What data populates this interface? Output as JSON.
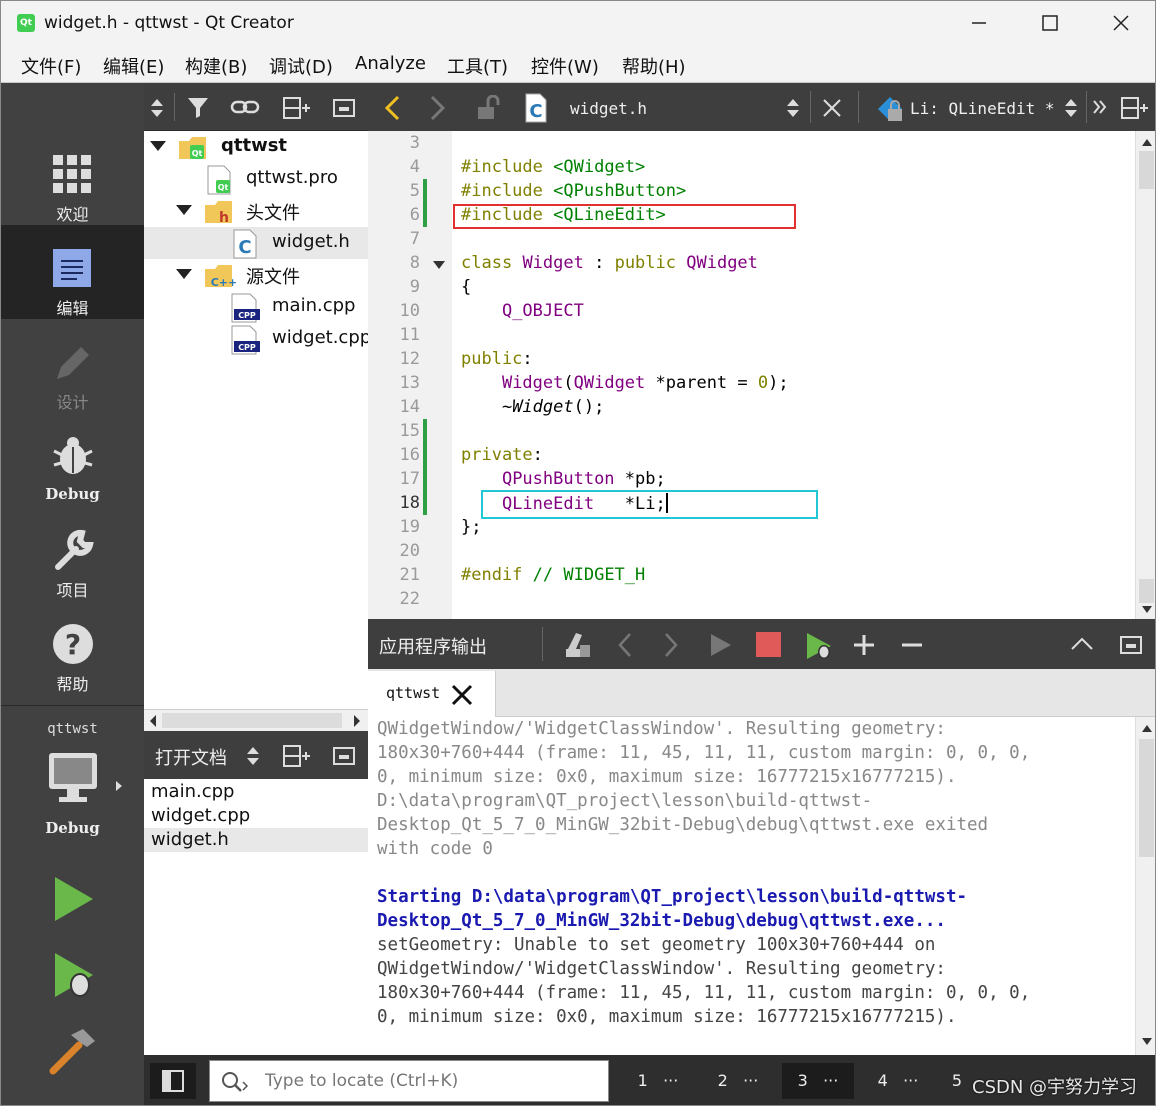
{
  "window": {
    "title": "widget.h - qttwst - Qt Creator",
    "app_icon_text": "Qt"
  },
  "menu": [
    "文件(F)",
    "编辑(E)",
    "构建(B)",
    "调试(D)",
    "Analyze",
    "工具(T)",
    "控件(W)",
    "帮助(H)"
  ],
  "modes": [
    {
      "label": "欢迎",
      "icon": "grid-icon"
    },
    {
      "label": "编辑",
      "icon": "edit-doc-icon",
      "active": true
    },
    {
      "label": "设计",
      "icon": "pencil-icon",
      "disabled": true
    },
    {
      "label": "Debug",
      "icon": "bug-icon"
    },
    {
      "label": "项目",
      "icon": "wrench-icon"
    },
    {
      "label": "帮助",
      "icon": "help-icon"
    }
  ],
  "kit": {
    "project": "qttwst",
    "config": "Debug"
  },
  "project_tree": [
    {
      "label": "qttwst",
      "bold": true,
      "icon": "qt-folder-icon"
    },
    {
      "label": "qttwst.pro",
      "icon": "qt-pro-file-icon"
    },
    {
      "label": "头文件",
      "icon": "header-folder-icon"
    },
    {
      "label": "widget.h",
      "icon": "c-header-file-icon",
      "selected": true
    },
    {
      "label": "源文件",
      "icon": "source-folder-icon"
    },
    {
      "label": "main.cpp",
      "icon": "cpp-file-icon"
    },
    {
      "label": "widget.cpp",
      "icon": "cpp-file-icon"
    }
  ],
  "open_docs": {
    "title": "打开文档",
    "items": [
      "main.cpp",
      "widget.cpp",
      "widget.h"
    ],
    "selected": "widget.h"
  },
  "editor": {
    "file_name": "widget.h",
    "symbol": "Li: QLineEdit *",
    "lines": [
      {
        "n": "3",
        "html": ""
      },
      {
        "n": "4",
        "html": "<span class=\"kw\">#include</span> <span class=\"str\">&lt;QWidget&gt;</span>"
      },
      {
        "n": "5",
        "html": "<span class=\"kw\">#include</span> <span class=\"str\">&lt;QPushButton&gt;</span>"
      },
      {
        "n": "6",
        "html": "<span class=\"kw\">#include</span> <span class=\"str\">&lt;QLineEdit&gt;</span>"
      },
      {
        "n": "7",
        "html": ""
      },
      {
        "n": "8",
        "html": "<span class=\"kw\">class</span> <span class=\"typ\">Widget</span> : <span class=\"kw\">public</span> <span class=\"typ\">QWidget</span>"
      },
      {
        "n": "9",
        "html": "{"
      },
      {
        "n": "10",
        "html": "    <span class=\"typ\">Q_OBJECT</span>"
      },
      {
        "n": "11",
        "html": ""
      },
      {
        "n": "12",
        "html": "<span class=\"kw\">public</span>:"
      },
      {
        "n": "13",
        "html": "    <span class=\"typ\">Widget</span>(<span class=\"typ\">QWidget</span> *parent = <span class=\"kw\">0</span>);"
      },
      {
        "n": "14",
        "html": "    ~<i>Widget</i>();"
      },
      {
        "n": "15",
        "html": ""
      },
      {
        "n": "16",
        "html": "<span class=\"kw\">private</span>:"
      },
      {
        "n": "17",
        "html": "    <span class=\"typ\">QPushButton</span> *pb;"
      },
      {
        "n": "18",
        "html": "    <span class=\"typ\">QLineEdit</span>   *Li;"
      },
      {
        "n": "19",
        "html": "};"
      },
      {
        "n": "20",
        "html": ""
      },
      {
        "n": "21",
        "html": "<span class=\"kw\">#endif</span> <span class=\"cm\">// WIDGET_H</span>"
      },
      {
        "n": "22",
        "html": ""
      }
    ],
    "current_line": "18"
  },
  "output": {
    "title": "应用程序输出",
    "tab": "qttwst",
    "lines": [
      {
        "cls": "out-gray",
        "text": "QWidgetWindow/'WidgetClassWindow'. Resulting geometry:"
      },
      {
        "cls": "out-gray",
        "text": "180x30+760+444 (frame: 11, 45, 11, 11, custom margin: 0, 0, 0,"
      },
      {
        "cls": "out-gray",
        "text": "0, minimum size: 0x0, maximum size: 16777215x16777215)."
      },
      {
        "cls": "out-gray",
        "text": "D:\\data\\program\\QT_project\\lesson\\build-qttwst-"
      },
      {
        "cls": "out-gray",
        "text": "Desktop_Qt_5_7_0_MinGW_32bit-Debug\\debug\\qttwst.exe exited"
      },
      {
        "cls": "out-gray",
        "text": "with code 0"
      },
      {
        "cls": "out-gray",
        "text": ""
      },
      {
        "cls": "out-blue",
        "text": "Starting D:\\data\\program\\QT_project\\lesson\\build-qttwst-"
      },
      {
        "cls": "out-blue",
        "text": "Desktop_Qt_5_7_0_MinGW_32bit-Debug\\debug\\qttwst.exe..."
      },
      {
        "cls": "out-dark",
        "text": "setGeometry: Unable to set geometry 100x30+760+444 on"
      },
      {
        "cls": "out-dark",
        "text": "QWidgetWindow/'WidgetClassWindow'. Resulting geometry:"
      },
      {
        "cls": "out-dark",
        "text": "180x30+760+444 (frame: 11, 45, 11, 11, custom margin: 0, 0, 0,"
      },
      {
        "cls": "out-dark",
        "text": "0, minimum size: 0x0, maximum size: 16777215x16777215)."
      }
    ]
  },
  "status": {
    "locator_placeholder": "Type to locate (Ctrl+K)",
    "panes": [
      "1",
      "2",
      "3",
      "4",
      "5"
    ],
    "active_pane": "3",
    "watermark": "CSDN @宇努力学习"
  },
  "colors": {
    "keyword": "#808000",
    "string": "#008000",
    "type": "#800080",
    "highlight_red": "#e03030",
    "highlight_cyan": "#20c8d6"
  }
}
